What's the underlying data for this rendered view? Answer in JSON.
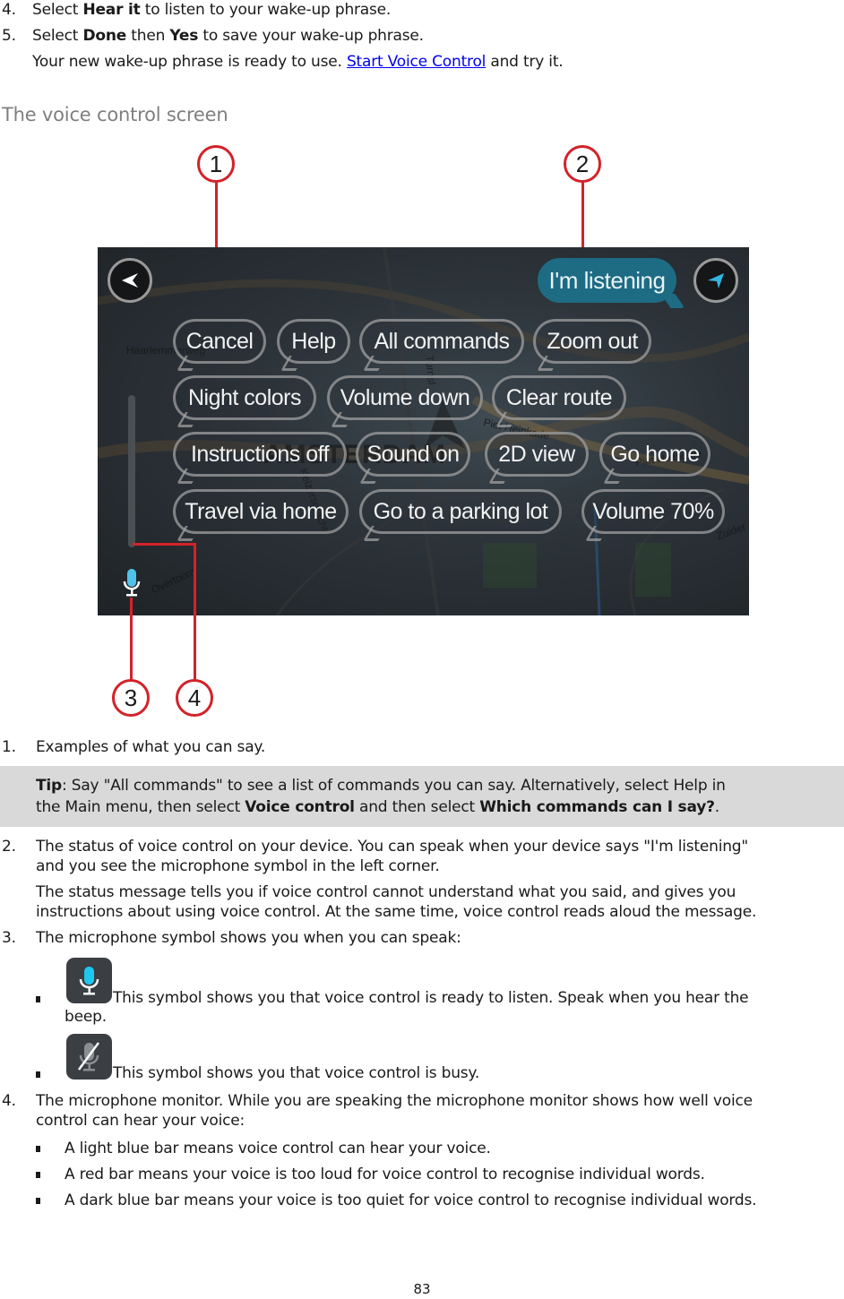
{
  "steps": {
    "step4": {
      "number": "4.",
      "pre": "Select ",
      "bold": "Hear it",
      "post": " to listen to your wake-up phrase."
    },
    "step5": {
      "number": "5.",
      "pre": "Select ",
      "bold1": "Done",
      "mid": " then ",
      "bold2": "Yes",
      "post": " to save your wake-up phrase."
    },
    "step5_followup": {
      "pre": "Your new wake-up phrase is ready to use. ",
      "link": "Start Voice Control",
      "post": " and try it."
    }
  },
  "section_heading": "The voice control screen",
  "screenshot": {
    "status_message": "I'm listening",
    "back_button_icon": "back-arrow-icon",
    "location_button_icon": "current-location-arrow-icon",
    "command_bubbles": [
      [
        "Cancel",
        "Help",
        "All commands",
        "Zoom out"
      ],
      [
        "Night colors",
        "Volume down",
        "Clear route"
      ],
      [
        "Instructions off",
        "Sound on",
        "2D view",
        "Go home"
      ],
      [
        "Travel via home",
        "Go to a parking lot",
        "Volume 70%"
      ]
    ],
    "map_labels": [
      "Haarlemmerweg",
      "AMSTERDAM",
      "Piet Heinkade",
      "Piet Heinkade",
      "Keizersgracht",
      "Overtoom",
      "Zuider",
      "Turnsl"
    ],
    "colors": {
      "listening_bubble": "#1e6b84",
      "mic_active": "#4fc3e8",
      "callout_red": "#d3222a"
    },
    "callouts": [
      "1",
      "2",
      "3",
      "4"
    ]
  },
  "legend": {
    "item1": {
      "number": "1.",
      "text": "Examples of what you can say."
    },
    "tip": {
      "label": "Tip",
      "line1_rest": ": Say \"All commands\" to see a list of commands you can say. Alternatively, select Help in",
      "line2_pre": "the Main menu, then select ",
      "line2_bold1": "Voice control",
      "line2_mid": " and then select ",
      "line2_bold2": "Which commands can I say?",
      "line2_post": "."
    },
    "item2": {
      "number": "2.",
      "line1": "The status of voice control on your device. You can speak when your device says \"I'm listening\"",
      "line2": "and you see the microphone symbol in the left corner.",
      "line3": "The status message tells you if voice control cannot understand what you said, and gives you",
      "line4": "instructions about using voice control. At the same time, voice control reads aloud the message."
    },
    "item3": {
      "number": "3.",
      "text": "The microphone symbol shows you when you can speak:",
      "sub": [
        {
          "icon": "microphone-ready-icon",
          "line1": " This symbol shows you that voice control is ready to listen. Speak when you hear the",
          "line2": "beep."
        },
        {
          "icon": "microphone-busy-icon",
          "line1": " This symbol shows you that voice control is busy."
        }
      ]
    },
    "item4": {
      "number": "4.",
      "line1": "The microphone monitor. While you are speaking the microphone monitor shows how well voice",
      "line2": "control can hear your voice:",
      "sub": [
        "A light blue bar means voice control can hear your voice.",
        "A red bar means your voice is too loud for voice control to recognise individual words.",
        "A dark blue bar means your voice is too quiet for voice control to recognise individual words."
      ]
    }
  },
  "page_number": "83"
}
